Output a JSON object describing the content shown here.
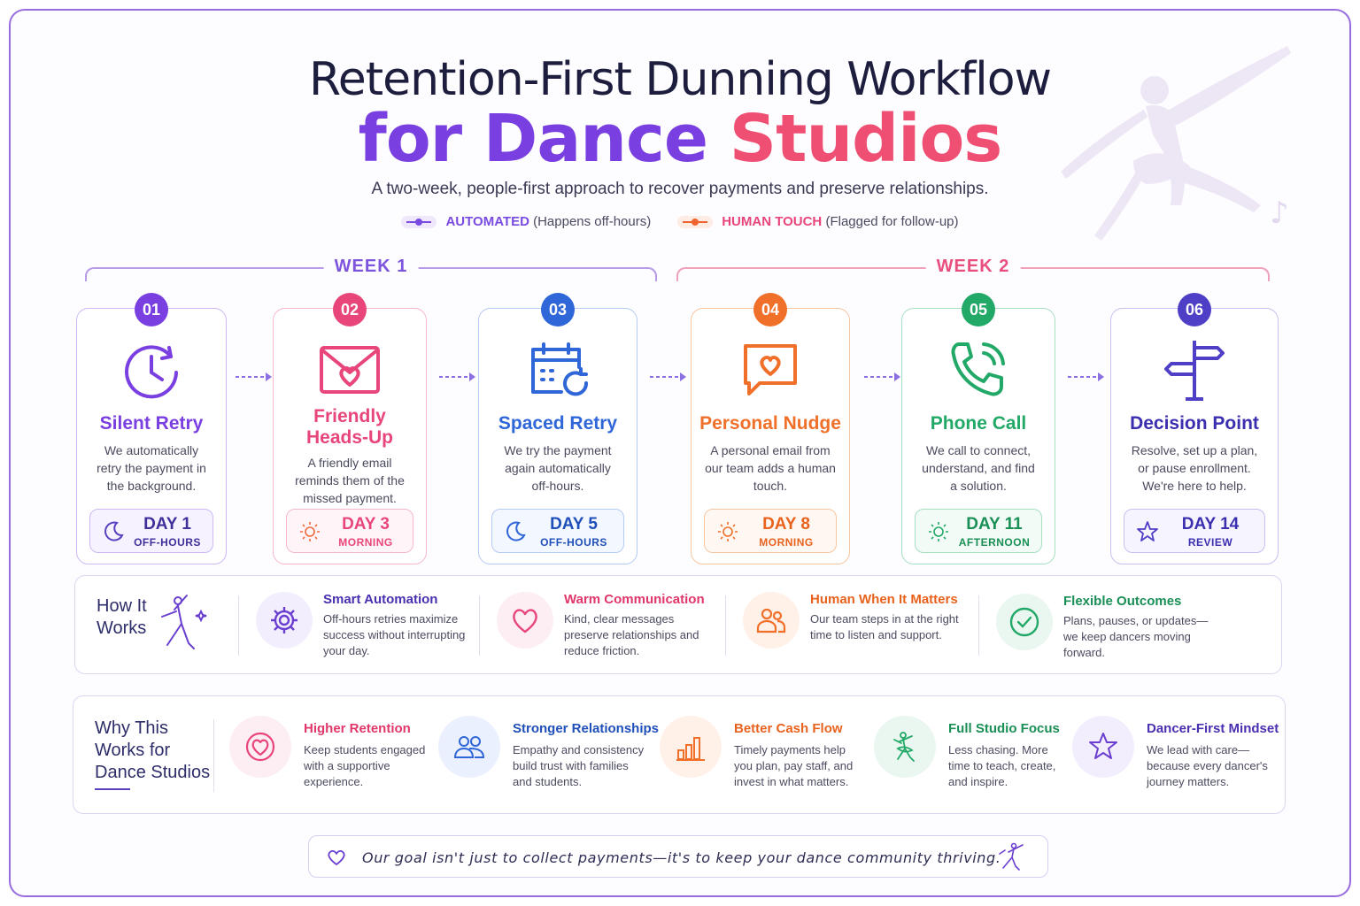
{
  "header": {
    "title_line1": "Retention-First Dunning Workflow",
    "title_part_a": "for Dance",
    "title_part_b": " Studios",
    "subtitle": "A two-week, people-first approach to recover payments and preserve relationships."
  },
  "legend": [
    {
      "key": "AUTOMATED",
      "desc": " (Happens off-hours)",
      "color": "#7a4be0"
    },
    {
      "key": "HUMAN TOUCH",
      "desc": " (Flagged for follow-up)",
      "color": "#f0622e"
    }
  ],
  "weeks": [
    {
      "label": "WEEK 1",
      "color": "#7d55dc"
    },
    {
      "label": "WEEK 2",
      "color": "#e84f7f"
    }
  ],
  "steps": [
    {
      "num": "01",
      "title": "Silent Retry",
      "desc": "We automatically retry the payment in the background.",
      "day": "DAY 1",
      "time": "OFF-HOURS",
      "color": "#7a3fe0",
      "icon": "clock-retry-icon"
    },
    {
      "num": "02",
      "title": "Friendly Heads-Up",
      "desc": "A friendly email reminds them of the missed payment.",
      "day": "DAY 3",
      "time": "MORNING",
      "color": "#e8467a",
      "icon": "envelope-heart-icon"
    },
    {
      "num": "03",
      "title": "Spaced Retry",
      "desc": "We try the payment again automatically off-hours.",
      "day": "DAY 5",
      "time": "OFF-HOURS",
      "color": "#2f66d8",
      "icon": "calendar-retry-icon"
    },
    {
      "num": "04",
      "title": "Personal Nudge",
      "desc": "A personal email from our team adds a human touch.",
      "day": "DAY 8",
      "time": "MORNING",
      "color": "#f0702a",
      "icon": "chat-heart-icon"
    },
    {
      "num": "05",
      "title": "Phone Call",
      "desc": "We call to connect, understand, and find a solution.",
      "day": "DAY 11",
      "time": "AFTERNOON",
      "color": "#22a968",
      "icon": "phone-icon"
    },
    {
      "num": "06",
      "title": "Decision Point",
      "desc": "Resolve, set up a plan, or pause enrollment. We're here to help.",
      "day": "DAY 14",
      "time": "REVIEW",
      "color": "#4f3fc6",
      "icon": "signpost-icon"
    }
  ],
  "how_it_works": {
    "title": "How It Works",
    "items": [
      {
        "title": "Smart Automation",
        "desc": "Off-hours retries maximize success without interrupting your day.",
        "color": "#6a3fd0",
        "icon": "gear-icon"
      },
      {
        "title": "Warm Communication",
        "desc": "Kind, clear messages preserve relationships and reduce friction.",
        "color": "#e8467a",
        "icon": "heart-icon"
      },
      {
        "title": "Human When It Matters",
        "desc": "Our team steps in at the right time to listen and support.",
        "color": "#f0702a",
        "icon": "people-icon"
      },
      {
        "title": "Flexible Outcomes",
        "desc": "Plans, pauses, or updates—we keep dancers moving forward.",
        "color": "#22a968",
        "icon": "check-circle-icon"
      }
    ]
  },
  "why_this_works": {
    "title": "Why This Works for Dance Studios",
    "items": [
      {
        "title": "Higher Retention",
        "desc": "Keep students engaged with a supportive experience.",
        "color": "#e8467a",
        "icon": "heart-icon"
      },
      {
        "title": "Stronger Relationships",
        "desc": "Empathy and consistency build trust with families and students.",
        "color": "#2f66d8",
        "icon": "people-icon"
      },
      {
        "title": "Better Cash Flow",
        "desc": "Timely payments help you plan, pay staff, and invest in what matters.",
        "color": "#f0702a",
        "icon": "bar-chart-icon"
      },
      {
        "title": "Full Studio Focus",
        "desc": "Less chasing. More time to teach, create, and inspire.",
        "color": "#22a968",
        "icon": "dancer-icon"
      },
      {
        "title": "Dancer-First Mindset",
        "desc": "We lead with care—because every dancer's journey matters.",
        "color": "#6a3fd0",
        "icon": "star-icon"
      }
    ]
  },
  "footer": {
    "quote": "Our goal isn't just to collect payments—it's to keep your dance community thriving."
  }
}
